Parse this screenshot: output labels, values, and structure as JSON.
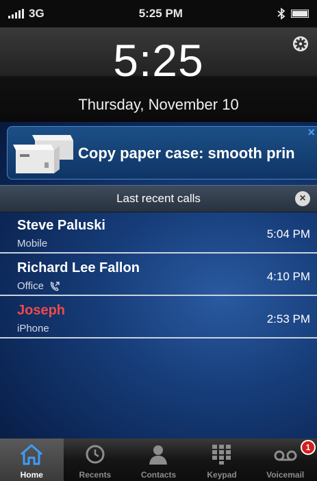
{
  "status_bar": {
    "carrier": "3G",
    "time": "5:25 PM",
    "icons": [
      "signal-icon",
      "bluetooth-icon",
      "battery-icon"
    ]
  },
  "lock": {
    "clock": "5:25",
    "date": "Thursday, November 10",
    "settings_icon": "gear-icon"
  },
  "ad": {
    "text": "Copy paper case: smooth prin",
    "close": "×"
  },
  "recent_calls": {
    "header": "Last recent calls",
    "close": "×",
    "items": [
      {
        "name": "Steve Paluski",
        "type": "Mobile",
        "time": "5:04 PM",
        "missed": false
      },
      {
        "name": "Richard Lee Fallon",
        "type": "Office",
        "time": "4:10 PM",
        "missed": false,
        "icon": "phone-forward-icon"
      },
      {
        "name": "Joseph",
        "type": "iPhone",
        "time": "2:53 PM",
        "missed": true
      }
    ]
  },
  "tabs": [
    {
      "label": "Home",
      "icon": "home-icon",
      "active": true
    },
    {
      "label": "Recents",
      "icon": "clock-icon",
      "active": false
    },
    {
      "label": "Contacts",
      "icon": "person-icon",
      "active": false
    },
    {
      "label": "Keypad",
      "icon": "keypad-icon",
      "active": false
    },
    {
      "label": "Voicemail",
      "icon": "voicemail-icon",
      "active": false,
      "badge": "1"
    }
  ],
  "colors": {
    "missed": "#ef4a4a",
    "accent": "#4f9bf0",
    "badge": "#d21e1e"
  }
}
